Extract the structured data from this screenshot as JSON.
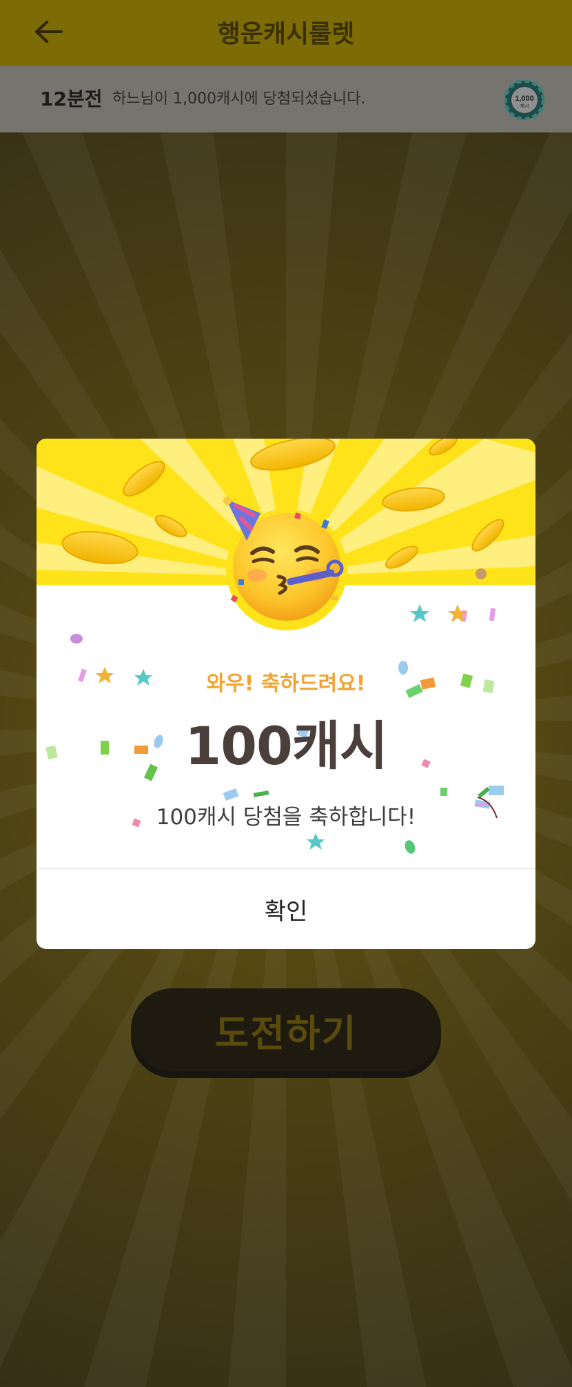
{
  "header": {
    "title": "행운캐시룰렛",
    "back_icon": "arrow-left-icon"
  },
  "ticker": {
    "time": "12분전",
    "message": "하느님이 1,000캐시에 당첨되셨습니다.",
    "chip_icon": "cash-chip-icon",
    "chip_amount": "1,000",
    "chip_unit": "캐시"
  },
  "main": {
    "challenge_label": "도전하기"
  },
  "modal": {
    "emoji_icon": "partying-face-icon",
    "subtitle": "와우! 축하드려요!",
    "prize": "100캐시",
    "description": "100캐시 당첨을 축하합니다!",
    "confirm_label": "확인"
  },
  "colors": {
    "brand_yellow": "#FFE010",
    "subtitle_orange": "#F2A330",
    "prize_text": "#4B3F3C",
    "overlay_bg": "#3A3219"
  }
}
